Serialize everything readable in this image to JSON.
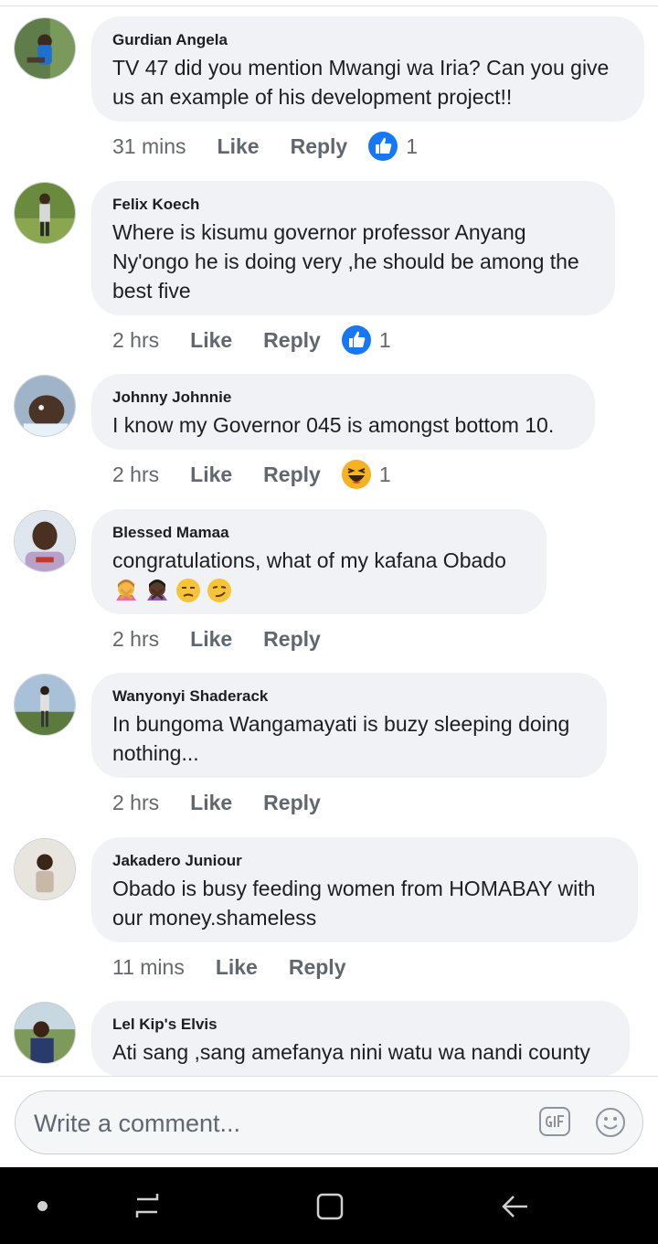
{
  "comments": [
    {
      "author": "Gurdian Angela",
      "text": "TV 47 did you mention Mwangi wa Iria? Can you give\nus an example of his development project!!",
      "time": "31 mins",
      "like_label": "Like",
      "reply_label": "Reply",
      "reaction": {
        "type": "like",
        "count": "1"
      }
    },
    {
      "author": "Felix Koech",
      "text": "Where is kisumu governor professor Anyang\nNy'ongo he is doing very ,he should be among the\nbest five",
      "time": "2 hrs",
      "like_label": "Like",
      "reply_label": "Reply",
      "reaction": {
        "type": "like",
        "count": "1"
      }
    },
    {
      "author": "Johnny Johnnie",
      "text": "I know my Governor 045 is amongst bottom 10.",
      "time": "2 hrs",
      "like_label": "Like",
      "reply_label": "Reply",
      "reaction": {
        "type": "haha",
        "count": "1"
      }
    },
    {
      "author": "Blessed Mamaa",
      "text": "congratulations, what of my kafana Obado",
      "emojis": [
        "woman-gesturing-no",
        "woman-gesturing-no-dark",
        "unamused-face",
        "smirking-face"
      ],
      "time": "2 hrs",
      "like_label": "Like",
      "reply_label": "Reply"
    },
    {
      "author": "Wanyonyi Shaderack",
      "text": "In bungoma Wangamayati is buzy sleeping doing\nnothing...",
      "time": "2 hrs",
      "like_label": "Like",
      "reply_label": "Reply"
    },
    {
      "author": "Jakadero Juniour",
      "text": "Obado is busy feeding women from HOMABAY with\nour money.shameless",
      "time": "11 mins",
      "like_label": "Like",
      "reply_label": "Reply"
    },
    {
      "author": "Lel Kip's Elvis",
      "text": "Ati sang ,sang amefanya nini watu wa nandi county"
    }
  ],
  "composer": {
    "placeholder": "Write a comment...",
    "gif_icon": "gif-icon",
    "emoji_icon": "smiley-icon"
  },
  "navbar": {
    "icons": [
      "nav-dot-icon",
      "recent-apps-icon",
      "home-icon",
      "back-icon"
    ]
  },
  "colors": {
    "bubble_bg": "#f0f2f5",
    "text": "#1c1e21",
    "meta": "#65676b",
    "like_blue": "#1877f2",
    "navbar": "#000000"
  }
}
